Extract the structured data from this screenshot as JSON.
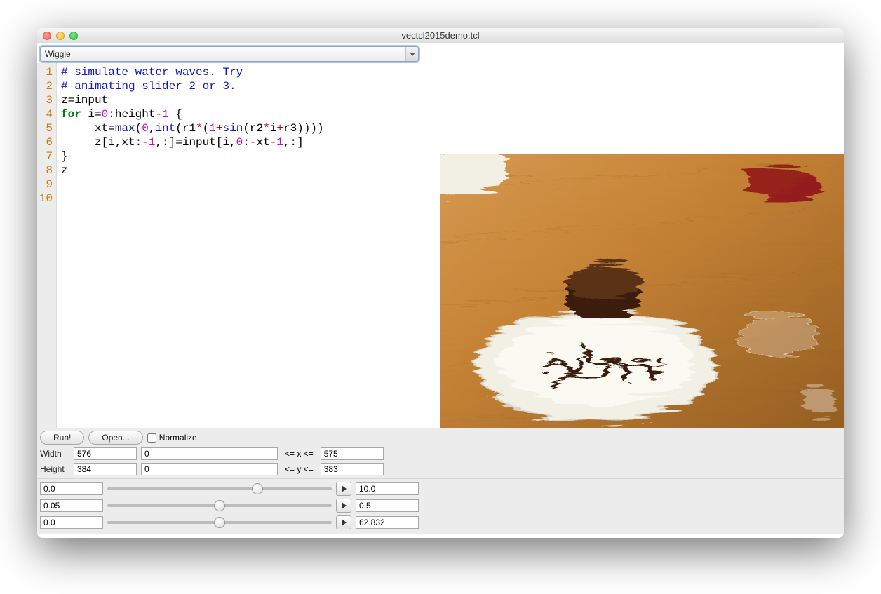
{
  "title": "vectcl2015demo.tcl",
  "dropdown": {
    "selected": "Wiggle"
  },
  "gutter": [
    "1",
    "2",
    "3",
    "4",
    "5",
    "6",
    "7",
    "8",
    "9",
    "10"
  ],
  "code": {
    "l1_comment": "# simulate water waves. Try",
    "l2_comment": "# animating slider 2 or 3.",
    "l3": "z=input",
    "l4_for": "for",
    "l4_rest_a": " i=",
    "l4_num0": "0",
    "l4_rest_b": ":height",
    "l4_minus": "-",
    "l4_num1": "1",
    "l4_rest_c": " {",
    "l5_indent": "     xt=",
    "l5_max": "max",
    "l5_p": "(",
    "l5_n0": "0",
    "l5_c1": ",",
    "l5_int": "int",
    "l5_p2": "(r1",
    "l5_star": "*",
    "l5_p3": "(",
    "l5_n1": "1",
    "l5_plus": "+",
    "l5_sin": "sin",
    "l5_p4": "(r2",
    "l5_star2": "*",
    "l5_i": "i",
    "l5_plus2": "+",
    "l5_r3": "r3))))",
    "l6_indent": "     z[i,xt:",
    "l6_m1": "-",
    "l6_n1": "1",
    "l6_mid": ",:]=input[i,",
    "l6_n0": "0",
    "l6_c": ":",
    "l6_m2": "-",
    "l6_xt": "xt",
    "l6_m3": "-",
    "l6_n1b": "1",
    "l6_end": ",:]",
    "l7": "}",
    "l8": "z"
  },
  "buttons": {
    "run": "Run!",
    "open": "Open...",
    "normalize": "Normalize"
  },
  "dims": {
    "width_label": "Width",
    "width_val": "576",
    "x_min": "0",
    "x_rng": "<= x <=",
    "x_max": "575",
    "height_label": "Height",
    "height_val": "384",
    "y_min": "0",
    "y_rng": "<= y <=",
    "y_max": "383"
  },
  "sliders": [
    {
      "min": "0.0",
      "max": "10.0",
      "pos": 67
    },
    {
      "min": "0.05",
      "max": "0.5",
      "pos": 50
    },
    {
      "min": "0.0",
      "max": "62.832",
      "pos": 50
    }
  ]
}
